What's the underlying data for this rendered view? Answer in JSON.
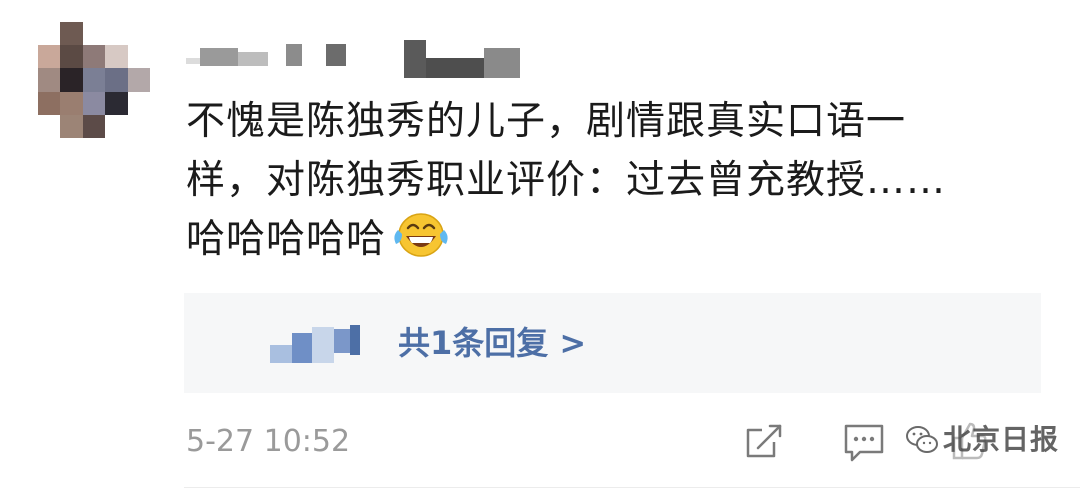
{
  "comment": {
    "text_line1": "不愧是陈独秀的儿子，剧情跟真实口语一",
    "text_line2": "样，对陈独秀职业评价：过去曾充教授……",
    "text_line3": "哈哈哈哈哈",
    "emoji": "laughing-with-tears"
  },
  "reply": {
    "link_label": "共1条回复 >"
  },
  "footer": {
    "timestamp": "5-27 10:52",
    "watermark_text": "北京日报"
  },
  "colors": {
    "link": "#4d6fa6",
    "timestamp": "#9a9a9a",
    "reply_bg": "#f6f7f8"
  }
}
